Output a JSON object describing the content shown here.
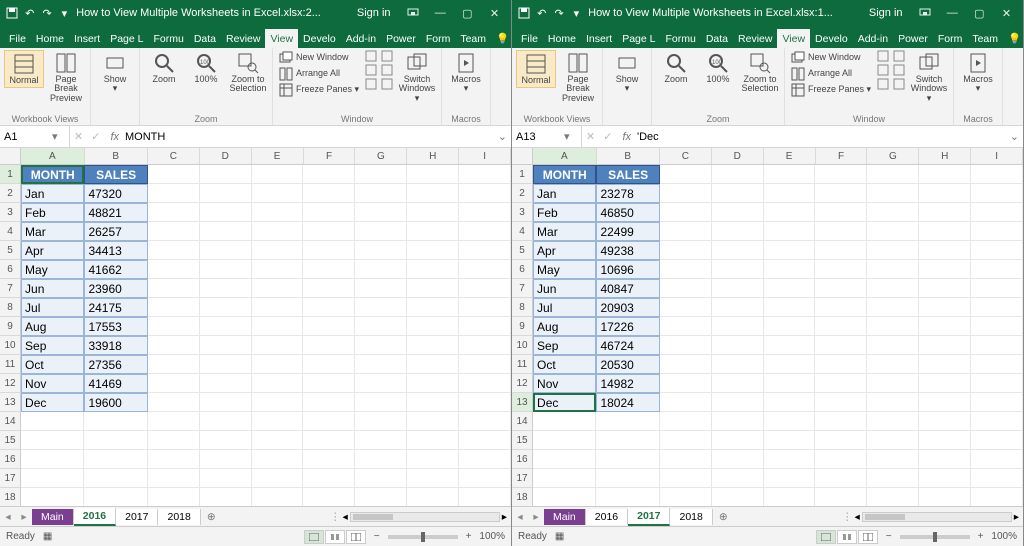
{
  "windows": [
    {
      "title": "How to View Multiple Worksheets in Excel.xlsx:2...",
      "active_cell_ref": "A1",
      "formula_value": "MONTH",
      "active_sheet_tab": "2016",
      "columns": [
        "A",
        "B",
        "C",
        "D",
        "E",
        "F",
        "G",
        "H",
        "I"
      ],
      "rows": 18,
      "selected_cell": {
        "row": 1,
        "col": "A"
      },
      "data": {
        "headers": [
          "MONTH",
          "SALES"
        ],
        "rows": [
          [
            "Jan",
            "47320"
          ],
          [
            "Feb",
            "48821"
          ],
          [
            "Mar",
            "26257"
          ],
          [
            "Apr",
            "34413"
          ],
          [
            "May",
            "41662"
          ],
          [
            "Jun",
            "23960"
          ],
          [
            "Jul",
            "24175"
          ],
          [
            "Aug",
            "17553"
          ],
          [
            "Sep",
            "33918"
          ],
          [
            "Oct",
            "27356"
          ],
          [
            "Nov",
            "41469"
          ],
          [
            "Dec",
            "19600"
          ]
        ]
      }
    },
    {
      "title": "How to View Multiple Worksheets in Excel.xlsx:1...",
      "active_cell_ref": "A13",
      "formula_value": "'Dec",
      "active_sheet_tab": "2017",
      "columns": [
        "A",
        "B",
        "C",
        "D",
        "E",
        "F",
        "G",
        "H",
        "I"
      ],
      "rows": 18,
      "selected_cell": {
        "row": 13,
        "col": "A"
      },
      "data": {
        "headers": [
          "MONTH",
          "SALES"
        ],
        "rows": [
          [
            "Jan",
            "23278"
          ],
          [
            "Feb",
            "46850"
          ],
          [
            "Mar",
            "22499"
          ],
          [
            "Apr",
            "49238"
          ],
          [
            "May",
            "10696"
          ],
          [
            "Jun",
            "40847"
          ],
          [
            "Jul",
            "20903"
          ],
          [
            "Aug",
            "17226"
          ],
          [
            "Sep",
            "46724"
          ],
          [
            "Oct",
            "20530"
          ],
          [
            "Nov",
            "14982"
          ],
          [
            "Dec",
            "18024"
          ]
        ]
      }
    }
  ],
  "common": {
    "signin": "Sign in",
    "menu_tabs": [
      "File",
      "Home",
      "Insert",
      "Page L",
      "Formu",
      "Data",
      "Review",
      "View",
      "Develo",
      "Add-in",
      "Power",
      "Form",
      "Team"
    ],
    "tellme": "Tell me",
    "ribbon": {
      "groups": [
        {
          "label": "Workbook Views",
          "buttons": [
            {
              "name": "normal",
              "label": "Normal",
              "active": true
            },
            {
              "name": "page-break-preview",
              "label": "Page Break\nPreview"
            }
          ]
        },
        {
          "label": "",
          "buttons": [
            {
              "name": "show",
              "label": "Show\n▾"
            }
          ]
        },
        {
          "label": "Zoom",
          "buttons": [
            {
              "name": "zoom",
              "label": "Zoom"
            },
            {
              "name": "zoom-100",
              "label": "100%"
            },
            {
              "name": "zoom-selection",
              "label": "Zoom to\nSelection"
            }
          ]
        },
        {
          "label": "Window",
          "stack": [
            {
              "name": "new-window",
              "label": "New Window"
            },
            {
              "name": "arrange-all",
              "label": "Arrange All"
            },
            {
              "name": "freeze-panes",
              "label": "Freeze Panes ▾"
            }
          ],
          "extras": true,
          "buttons": [
            {
              "name": "switch-windows",
              "label": "Switch\nWindows ▾"
            }
          ]
        },
        {
          "label": "Macros",
          "buttons": [
            {
              "name": "macros",
              "label": "Macros\n▾"
            }
          ]
        }
      ]
    },
    "sheet_tabs": [
      "Main",
      "2016",
      "2017",
      "2018"
    ],
    "status_ready": "Ready",
    "zoom_pct": "100%"
  }
}
